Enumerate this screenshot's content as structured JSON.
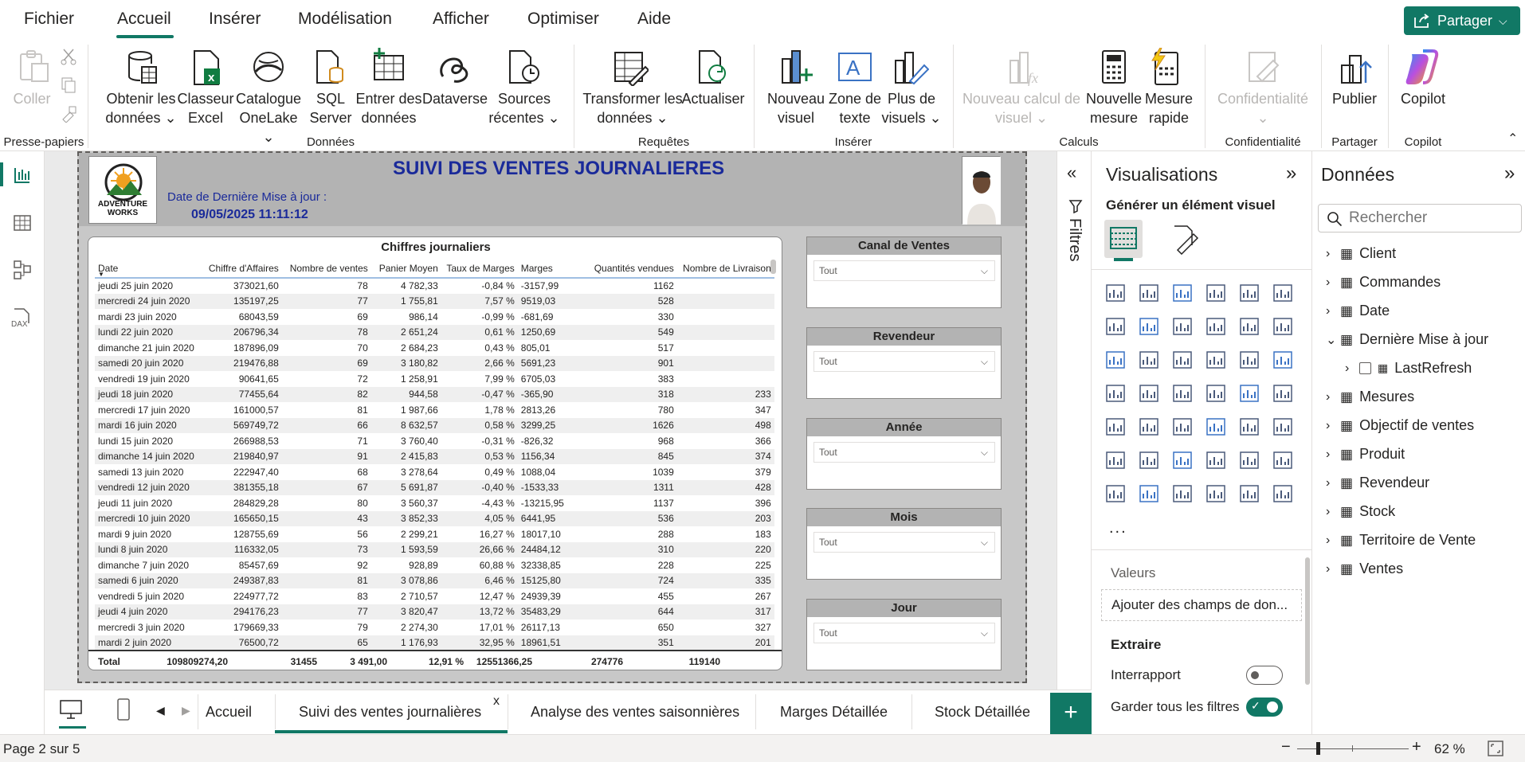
{
  "menu": {
    "items": [
      "Fichier",
      "Accueil",
      "Insérer",
      "Modélisation",
      "Afficher",
      "Optimiser",
      "Aide"
    ],
    "active": "Accueil",
    "share_label": "Partager"
  },
  "ribbon": {
    "clipboard": {
      "paste": "Coller",
      "group": "Presse-papiers"
    },
    "data": {
      "get_data": [
        "Obtenir les",
        "données"
      ],
      "excel": [
        "Classeur",
        "Excel"
      ],
      "onelake": [
        "Catalogue",
        "OneLake"
      ],
      "sql": [
        "SQL",
        "Server"
      ],
      "enter": [
        "Entrer des",
        "données"
      ],
      "dataverse": "Dataverse",
      "recent": [
        "Sources",
        "récentes"
      ],
      "group": "Données"
    },
    "queries": {
      "transform": [
        "Transformer les",
        "données"
      ],
      "refresh": "Actualiser",
      "group": "Requêtes"
    },
    "insert": {
      "new_visual": [
        "Nouveau",
        "visuel"
      ],
      "textbox": [
        "Zone de",
        "texte"
      ],
      "more": [
        "Plus de",
        "visuels"
      ],
      "group": "Insérer"
    },
    "calc": {
      "new_calc": [
        "Nouveau calcul de",
        "visuel"
      ],
      "new_measure": [
        "Nouvelle",
        "mesure"
      ],
      "quick_measure": [
        "Mesure",
        "rapide"
      ],
      "group": "Calculs"
    },
    "sensitivity": {
      "label": "Confidentialité",
      "group": "Confidentialité"
    },
    "share": {
      "publish": "Publier",
      "group": "Partager"
    },
    "copilot": {
      "label": "Copilot",
      "group": "Copilot"
    }
  },
  "report": {
    "title": "SUIVI DES VENTES JOURNALIERES",
    "update_label": "Date de Dernière Mise à jour :",
    "update_value": "09/05/2025 11:11:12",
    "logo_text": [
      "ADVENTURE",
      "WORKS"
    ]
  },
  "table": {
    "title": "Chiffres journaliers",
    "columns": [
      "Date",
      "Chiffre d'Affaires",
      "Nombre de ventes",
      "Panier Moyen",
      "Taux de Marges",
      "Marges",
      "Quantités vendues",
      "Nombre de Livraison"
    ],
    "rows": [
      [
        "jeudi 25 juin 2020",
        "373021,60",
        "78",
        "4 782,33",
        "-0,84 %",
        "-3157,99",
        "1162",
        ""
      ],
      [
        "mercredi 24 juin 2020",
        "135197,25",
        "77",
        "1 755,81",
        "7,57 %",
        "9519,03",
        "528",
        ""
      ],
      [
        "mardi 23 juin 2020",
        "68043,59",
        "69",
        "986,14",
        "-0,99 %",
        "-681,69",
        "330",
        ""
      ],
      [
        "lundi 22 juin 2020",
        "206796,34",
        "78",
        "2 651,24",
        "0,61 %",
        "1250,69",
        "549",
        ""
      ],
      [
        "dimanche 21 juin 2020",
        "187896,09",
        "70",
        "2 684,23",
        "0,43 %",
        "805,01",
        "517",
        ""
      ],
      [
        "samedi 20 juin 2020",
        "219476,88",
        "69",
        "3 180,82",
        "2,66 %",
        "5691,23",
        "901",
        ""
      ],
      [
        "vendredi 19 juin 2020",
        "90641,65",
        "72",
        "1 258,91",
        "7,99 %",
        "6705,03",
        "383",
        ""
      ],
      [
        "jeudi 18 juin 2020",
        "77455,64",
        "82",
        "944,58",
        "-0,47 %",
        "-365,90",
        "318",
        "233"
      ],
      [
        "mercredi 17 juin 2020",
        "161000,57",
        "81",
        "1 987,66",
        "1,78 %",
        "2813,26",
        "780",
        "347"
      ],
      [
        "mardi 16 juin 2020",
        "569749,72",
        "66",
        "8 632,57",
        "0,58 %",
        "3299,25",
        "1626",
        "498"
      ],
      [
        "lundi 15 juin 2020",
        "266988,53",
        "71",
        "3 760,40",
        "-0,31 %",
        "-826,32",
        "968",
        "366"
      ],
      [
        "dimanche 14 juin 2020",
        "219840,97",
        "91",
        "2 415,83",
        "0,53 %",
        "1156,34",
        "845",
        "374"
      ],
      [
        "samedi 13 juin 2020",
        "222947,40",
        "68",
        "3 278,64",
        "0,49 %",
        "1088,04",
        "1039",
        "379"
      ],
      [
        "vendredi 12 juin 2020",
        "381355,18",
        "67",
        "5 691,87",
        "-0,40 %",
        "-1533,33",
        "1311",
        "428"
      ],
      [
        "jeudi 11 juin 2020",
        "284829,28",
        "80",
        "3 560,37",
        "-4,43 %",
        "-13215,95",
        "1137",
        "396"
      ],
      [
        "mercredi 10 juin 2020",
        "165650,15",
        "43",
        "3 852,33",
        "4,05 %",
        "6441,95",
        "536",
        "203"
      ],
      [
        "mardi 9 juin 2020",
        "128755,69",
        "56",
        "2 299,21",
        "16,27 %",
        "18017,10",
        "288",
        "183"
      ],
      [
        "lundi 8 juin 2020",
        "116332,05",
        "73",
        "1 593,59",
        "26,66 %",
        "24484,12",
        "310",
        "220"
      ],
      [
        "dimanche 7 juin 2020",
        "85457,69",
        "92",
        "928,89",
        "60,88 %",
        "32338,85",
        "228",
        "225"
      ],
      [
        "samedi 6 juin 2020",
        "249387,83",
        "81",
        "3 078,86",
        "6,46 %",
        "15125,80",
        "724",
        "335"
      ],
      [
        "vendredi 5 juin 2020",
        "224977,72",
        "83",
        "2 710,57",
        "12,47 %",
        "24939,39",
        "455",
        "267"
      ],
      [
        "jeudi 4 juin 2020",
        "294176,23",
        "77",
        "3 820,47",
        "13,72 %",
        "35483,29",
        "644",
        "317"
      ],
      [
        "mercredi 3 juin 2020",
        "179669,33",
        "79",
        "2 274,30",
        "17,01 %",
        "26117,13",
        "650",
        "327"
      ],
      [
        "mardi 2 juin 2020",
        "76500,72",
        "65",
        "1 176,93",
        "32,95 %",
        "18961,51",
        "351",
        "201"
      ]
    ],
    "total": [
      "Total",
      "109809274,20",
      "31455",
      "3 491,00",
      "12,91 %",
      "12551366,25",
      "274776",
      "119140"
    ]
  },
  "slicers": [
    {
      "title": "Canal de Ventes",
      "value": "Tout"
    },
    {
      "title": "Revendeur",
      "value": "Tout"
    },
    {
      "title": "Année",
      "value": "Tout"
    },
    {
      "title": "Mois",
      "value": "Tout"
    },
    {
      "title": "Jour",
      "value": "Tout"
    }
  ],
  "filters_label": "Filtres",
  "viz": {
    "title": "Visualisations",
    "build_label": "Générer un élément visuel",
    "values_label": "Valeurs",
    "values_placeholder": "Ajouter des champs de don...",
    "drill_label": "Extraire",
    "cross_report": "Interrapport",
    "keep_filters": "Garder tous les filtres",
    "more": "..."
  },
  "data_pane": {
    "title": "Données",
    "search_placeholder": "Rechercher",
    "tables": [
      "Client",
      "Commandes",
      "Date",
      "Dernière Mise à jour",
      "LastRefresh",
      "Mesures",
      "Objectif de ventes",
      "Produit",
      "Revendeur",
      "Stock",
      "Territoire de Vente",
      "Ventes"
    ]
  },
  "tabs": {
    "items": [
      "Accueil",
      "Suivi des ventes journalières",
      "Analyse des ventes saisonnières",
      "Marges Détaillée",
      "Stock Détaillée"
    ],
    "active": "Suivi des ventes journalières"
  },
  "status": {
    "page": "Page 2 sur 5",
    "zoom": "62 %"
  },
  "colors": {
    "accent": "#117865",
    "title_blue": "#1a2a9a"
  }
}
